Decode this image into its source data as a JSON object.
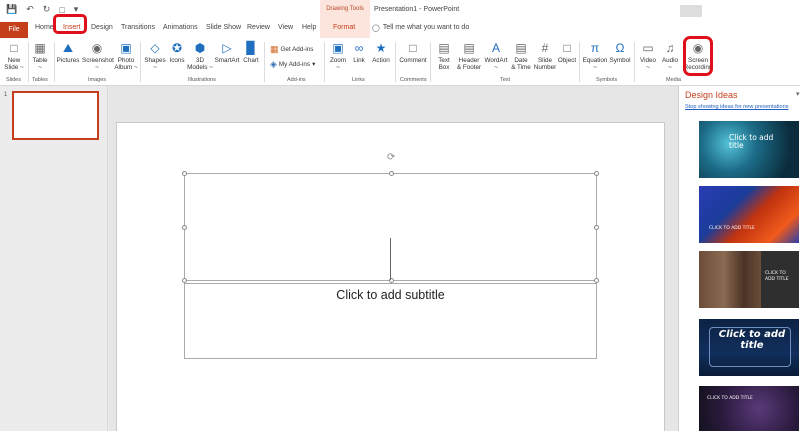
{
  "window": {
    "drawing_tools": "Drawing Tools",
    "title": "Presentation1 - PowerPoint"
  },
  "tabs": {
    "file": "File",
    "home": "Home",
    "insert": "Insert",
    "design": "Design",
    "transitions": "Transitions",
    "animations": "Animations",
    "slideshow": "Slide Show",
    "review": "Review",
    "view": "View",
    "help": "Help",
    "format": "Format",
    "tell_me": "Tell me what you want to do"
  },
  "ribbon": {
    "new_slide": [
      "New",
      "Slide ~"
    ],
    "table": [
      "Table",
      "~"
    ],
    "pictures": "Pictures",
    "screenshot": [
      "Screenshot",
      "~"
    ],
    "photo_album": [
      "Photo",
      "Album ~"
    ],
    "shapes": [
      "Shapes",
      "~"
    ],
    "icons": "Icons",
    "models_3d": [
      "3D",
      "Models ~"
    ],
    "smartart": "SmartArt",
    "chart": "Chart",
    "get_addins": "Get Add-ins",
    "my_addins": "My Add-ins",
    "zoom": [
      "Zoom",
      "~"
    ],
    "link": "Link",
    "action": "Action",
    "comment": "Comment",
    "text_box": [
      "Text",
      "Box"
    ],
    "header_footer": [
      "Header",
      "& Footer"
    ],
    "wordart": [
      "WordArt",
      "~"
    ],
    "date_time": [
      "Date",
      "& Time"
    ],
    "slide_number": [
      "Slide",
      "Number"
    ],
    "object": "Object",
    "equation": [
      "Equation",
      "~"
    ],
    "symbol": "Symbol",
    "video": [
      "Video",
      "~"
    ],
    "audio": [
      "Audio",
      "~"
    ],
    "screen_recording": [
      "Screen",
      "Recording"
    ]
  },
  "groups": {
    "slides": "Slides",
    "tables": "Tables",
    "images": "Images",
    "illustrations": "Illustrations",
    "addins": "Add-ins",
    "links": "Links",
    "comments": "Comments",
    "text": "Text",
    "symbols": "Symbols",
    "media": "Media"
  },
  "thumbnails": {
    "slide_number": "1"
  },
  "slide": {
    "subtitle_placeholder": "Click to add subtitle"
  },
  "design_ideas": {
    "title": "Design Ideas",
    "stop_link": "Stop showing ideas for new presentations",
    "idea1_text": "Click to add title",
    "idea2_text": "CLICK TO ADD TITLE",
    "idea3_text": "CLICK TO ADD TITLE",
    "idea4_text": "Click to add title",
    "idea5_text": "CLICK TO ADD TITLE"
  }
}
